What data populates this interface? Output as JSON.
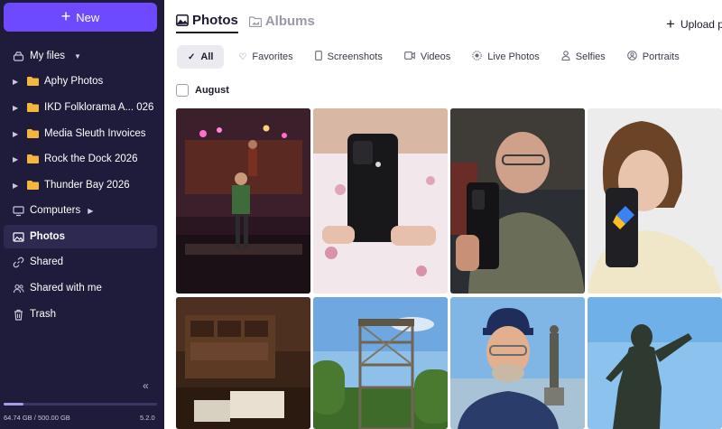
{
  "sidebar": {
    "new_label": "New",
    "my_files_label": "My files",
    "folders": [
      {
        "label": "Aphy Photos"
      },
      {
        "label": "IKD Folklorama A... 026"
      },
      {
        "label": "Media Sleuth Invoices"
      },
      {
        "label": "Rock the Dock 2026"
      },
      {
        "label": "Thunder Bay 2026"
      }
    ],
    "computers_label": "Computers",
    "photos_label": "Photos",
    "shared_label": "Shared",
    "shared_with_me_label": "Shared with me",
    "trash_label": "Trash",
    "storage_text": "64.74 GB / 500.00 GB",
    "storage_used_fraction": 0.13,
    "version": "5.2.0",
    "collapse_icon": "double-chevron-left-icon"
  },
  "header": {
    "photos_tab": "Photos",
    "albums_tab": "Albums",
    "upload_label": "Upload p"
  },
  "filters": [
    {
      "label": "All",
      "icon": "check-icon",
      "active": true
    },
    {
      "label": "Favorites",
      "icon": "heart-icon"
    },
    {
      "label": "Screenshots",
      "icon": "phone-icon"
    },
    {
      "label": "Videos",
      "icon": "video-icon"
    },
    {
      "label": "Live Photos",
      "icon": "live-icon"
    },
    {
      "label": "Selfies",
      "icon": "person-icon"
    },
    {
      "label": "Portraits",
      "icon": "portrait-icon"
    }
  ],
  "section": {
    "label": "August"
  },
  "colors": {
    "sidebar_bg": "#1f1b3a",
    "accent": "#6d4aff",
    "active_item": "#2e2950"
  }
}
